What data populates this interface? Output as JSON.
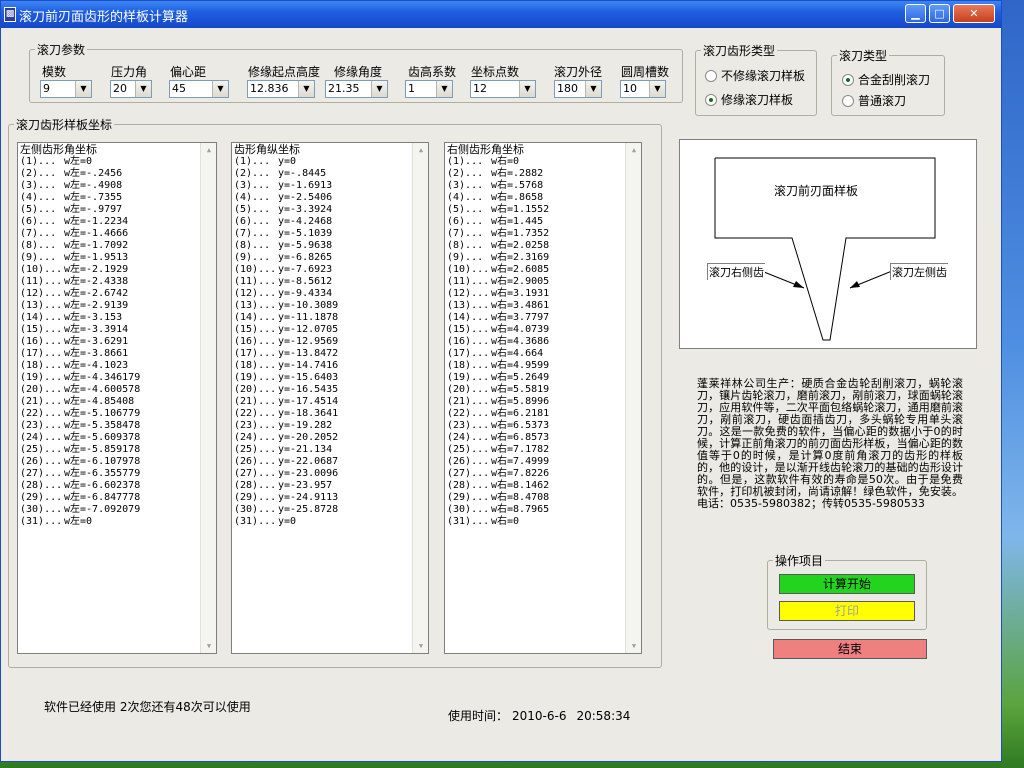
{
  "window": {
    "title": "滚刀前刃面齿形的样板计算器",
    "controls": {
      "minimize": "▁",
      "maximize": "□",
      "close": "✕"
    }
  },
  "params": {
    "group_label": "滚刀参数",
    "fields": [
      {
        "label": "模数",
        "value": "9"
      },
      {
        "label": "压力角",
        "value": "20"
      },
      {
        "label": "偏心距",
        "value": "45"
      },
      {
        "label": "修缘起点高度",
        "value": "12.836"
      },
      {
        "label": "修缘角度",
        "value": "21.35"
      },
      {
        "label": "齿高系数",
        "value": "1"
      },
      {
        "label": "坐标点数",
        "value": "12"
      },
      {
        "label": "滚刀外径",
        "value": "180"
      },
      {
        "label": "圆周槽数",
        "value": "10"
      }
    ]
  },
  "profile_type": {
    "group_label": "滚刀齿形类型",
    "options": [
      {
        "label": "不修缘滚刀样板",
        "selected": false
      },
      {
        "label": "修缘滚刀样板",
        "selected": true
      }
    ]
  },
  "hob_type": {
    "group_label": "滚刀类型",
    "options": [
      {
        "label": "合金刮削滚刀",
        "selected": true
      },
      {
        "label": "普通滚刀",
        "selected": false
      }
    ]
  },
  "coords": {
    "group_label": "滚刀齿形样板坐标",
    "left": {
      "header": "左侧齿形角坐标",
      "rows": [
        [
          "(1)...",
          "w左=0"
        ],
        [
          "(2)...",
          "w左=-.2456"
        ],
        [
          "(3)...",
          "w左=-.4908"
        ],
        [
          "(4)...",
          "w左=-.7355"
        ],
        [
          "(5)...",
          "w左=-.9797"
        ],
        [
          "(6)...",
          "w左=-1.2234"
        ],
        [
          "(7)...",
          "w左=-1.4666"
        ],
        [
          "(8)...",
          "w左=-1.7092"
        ],
        [
          "(9)...",
          "w左=-1.9513"
        ],
        [
          "(10)...",
          "w左=-2.1929"
        ],
        [
          "(11)...",
          "w左=-2.4338"
        ],
        [
          "(12)...",
          "w左=-2.6742"
        ],
        [
          "(13)...",
          "w左=-2.9139"
        ],
        [
          "(14)...",
          "w左=-3.153"
        ],
        [
          "(15)...",
          "w左=-3.3914"
        ],
        [
          "(16)...",
          "w左=-3.6291"
        ],
        [
          "(17)...",
          "w左=-3.8661"
        ],
        [
          "(18)...",
          "w左=-4.1023"
        ],
        [
          "(19)...",
          "w左=-4.346179"
        ],
        [
          "(20)...",
          "w左=-4.600578"
        ],
        [
          "(21)...",
          "w左=-4.85408"
        ],
        [
          "(22)...",
          "w左=-5.106779"
        ],
        [
          "(23)...",
          "w左=-5.358478"
        ],
        [
          "(24)...",
          "w左=-5.609378"
        ],
        [
          "(25)...",
          "w左=-5.859178"
        ],
        [
          "(26)...",
          "w左=-6.107978"
        ],
        [
          "(27)...",
          "w左=-6.355779"
        ],
        [
          "(28)...",
          "w左=-6.602378"
        ],
        [
          "(29)...",
          "w左=-6.847778"
        ],
        [
          "(30)...",
          "w左=-7.092079"
        ],
        [
          "(31)...",
          "w左=0"
        ]
      ]
    },
    "middle": {
      "header": "齿形角纵坐标",
      "rows": [
        [
          "(1)...",
          "y=0"
        ],
        [
          "(2)...",
          "y=-.8445"
        ],
        [
          "(3)...",
          "y=-1.6913"
        ],
        [
          "(4)...",
          "y=-2.5406"
        ],
        [
          "(5)...",
          "y=-3.3924"
        ],
        [
          "(6)...",
          "y=-4.2468"
        ],
        [
          "(7)...",
          "y=-5.1039"
        ],
        [
          "(8)...",
          "y=-5.9638"
        ],
        [
          "(9)...",
          "y=-6.8265"
        ],
        [
          "(10)...",
          "y=-7.6923"
        ],
        [
          "(11)...",
          "y=-8.5612"
        ],
        [
          "(12)...",
          "y=-9.4334"
        ],
        [
          "(13)...",
          "y=-10.3089"
        ],
        [
          "(14)...",
          "y=-11.1878"
        ],
        [
          "(15)...",
          "y=-12.0705"
        ],
        [
          "(16)...",
          "y=-12.9569"
        ],
        [
          "(17)...",
          "y=-13.8472"
        ],
        [
          "(18)...",
          "y=-14.7416"
        ],
        [
          "(19)...",
          "y=-15.6403"
        ],
        [
          "(20)...",
          "y=-16.5435"
        ],
        [
          "(21)...",
          "y=-17.4514"
        ],
        [
          "(22)...",
          "y=-18.3641"
        ],
        [
          "(23)...",
          "y=-19.282"
        ],
        [
          "(24)...",
          "y=-20.2052"
        ],
        [
          "(25)...",
          "y=-21.134"
        ],
        [
          "(26)...",
          "y=-22.0687"
        ],
        [
          "(27)...",
          "y=-23.0096"
        ],
        [
          "(28)...",
          "y=-23.957"
        ],
        [
          "(29)...",
          "y=-24.9113"
        ],
        [
          "(30)...",
          "y=-25.8728"
        ],
        [
          "(31)...",
          "y=0"
        ]
      ]
    },
    "right": {
      "header": "右侧齿形角坐标",
      "rows": [
        [
          "(1)...",
          "w右=0"
        ],
        [
          "(2)...",
          "w右=.2882"
        ],
        [
          "(3)...",
          "w右=.5768"
        ],
        [
          "(4)...",
          "w右=.8658"
        ],
        [
          "(5)...",
          "w右=1.1552"
        ],
        [
          "(6)...",
          "w右=1.445"
        ],
        [
          "(7)...",
          "w右=1.7352"
        ],
        [
          "(8)...",
          "w右=2.0258"
        ],
        [
          "(9)...",
          "w右=2.3169"
        ],
        [
          "(10)...",
          "w右=2.6085"
        ],
        [
          "(11)...",
          "w右=2.9005"
        ],
        [
          "(12)...",
          "w右=3.1931"
        ],
        [
          "(13)...",
          "w右=3.4861"
        ],
        [
          "(14)...",
          "w右=3.7797"
        ],
        [
          "(15)...",
          "w右=4.0739"
        ],
        [
          "(16)...",
          "w右=4.3686"
        ],
        [
          "(17)...",
          "w右=4.664"
        ],
        [
          "(18)...",
          "w右=4.9599"
        ],
        [
          "(19)...",
          "w右=5.2649"
        ],
        [
          "(20)...",
          "w右=5.5819"
        ],
        [
          "(21)...",
          "w右=5.8996"
        ],
        [
          "(22)...",
          "w右=6.2181"
        ],
        [
          "(23)...",
          "w右=6.5373"
        ],
        [
          "(24)...",
          "w右=6.8573"
        ],
        [
          "(25)...",
          "w右=7.1782"
        ],
        [
          "(26)...",
          "w右=7.4999"
        ],
        [
          "(27)...",
          "w右=7.8226"
        ],
        [
          "(28)...",
          "w右=8.1462"
        ],
        [
          "(29)...",
          "w右=8.4708"
        ],
        [
          "(30)...",
          "w右=8.7965"
        ],
        [
          "(31)...",
          "w右=0"
        ]
      ]
    }
  },
  "diagram": {
    "box_label": "滚刀前刃面样板",
    "right_flank_label": "滚刀右侧齿",
    "left_flank_label": "滚刀左侧齿"
  },
  "info_text": "蓬莱祥林公司生产：硬质合金齿轮刮削滚刀，蜗轮滚刀，镶片齿轮滚刀，磨前滚刀，剐前滚刀，球面蜗轮滚刀，应用软件等，二次平面包络蜗轮滚刀，通用磨前滚刀，剐前滚刀，硬齿面插齿刀，多头蜗轮专用单头滚刀。这是一款免费的软件，当偏心距的数据小于0的时候，计算正前角滚刀的前刃面齿形样板，当偏心距的数值等于0的时候，是计算0度前角滚刀的齿形的样板的，他的设计，是以渐开线齿轮滚刀的基础的齿形设计的。但是，这款软件有效的寿命是50次。由于是免费软件，打印机被封闭，尚请谅解！绿色软件，免安装。 电话：0535-5980382；传转0535-5980533",
  "operations": {
    "group_label": "操作项目",
    "start_label": "计算开始",
    "print_label": "打印",
    "end_label": "结束"
  },
  "status": {
    "usage": "软件已经使用 2次您还有48次可以使用",
    "time_label": "使用时间：",
    "date": "2010-6-6",
    "time": "20:58:34"
  },
  "colors": {
    "start_button": "#22d41e",
    "print_button": "#ffff00",
    "end_button": "#ee8080"
  }
}
